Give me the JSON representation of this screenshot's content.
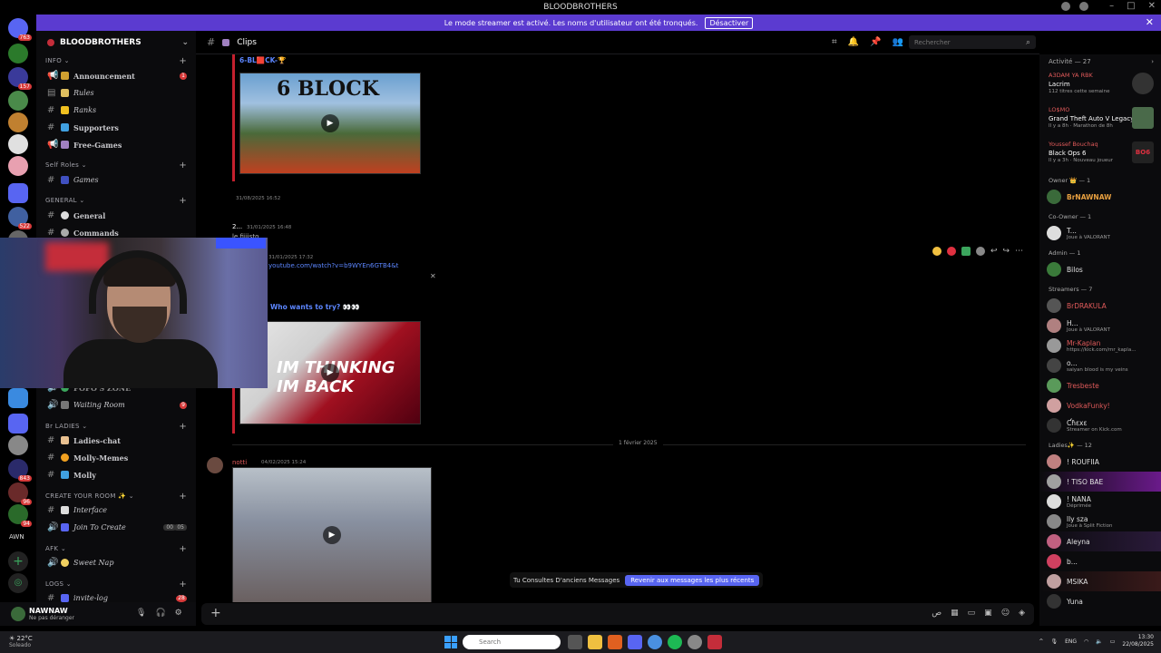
{
  "window": {
    "title": "BLOODBROTHERS"
  },
  "banner": {
    "text": "Le mode streamer est activé. Les noms d'utilisateur ont été tronqués.",
    "button": "Désactiver"
  },
  "guilds": {
    "badges": [
      "763",
      "157",
      "522",
      "843",
      "96",
      "94"
    ],
    "label": "AWN"
  },
  "server": {
    "name": "BLOODBROTHERS"
  },
  "categories": {
    "info": "INFO",
    "self_roles": "Self Roles",
    "general": "GENERAL",
    "br_ladies": "Br LADIES",
    "create_room": "CREATE YOUR ROOM ✨",
    "afk": "AFK",
    "logs": "LOGS"
  },
  "channels": {
    "announcement": "Announcement",
    "rules": "Rules",
    "ranks": "Ranks",
    "supporters": "Supporters",
    "free_games": "Free-Games",
    "games": "Games",
    "general": "General",
    "commands": "Commands",
    "popos_zone": "POPO'S ZONE",
    "waiting_room": "Waiting Room",
    "ladies_chat": "Ladies-chat",
    "molly_memes": "Molly-Memes",
    "molly": "Molly",
    "interface": "Interface",
    "join_to_create": "Join To Create",
    "join_count": "00",
    "join_limit": "05",
    "sweet_nap": "Sweet Nap",
    "invite_log": "invite-log",
    "announcement_badge": "1",
    "waiting_badge": "9",
    "invite_badge": "28"
  },
  "chat": {
    "channel": "Clips",
    "search_placeholder": "Rechercher",
    "embed1_title": "6-BL🟥CK-🏆",
    "msg_ts1": "31/08/2025 16:52",
    "msg_ts2": "31/01/2025 16:48",
    "msg_user2": "2...",
    "msg_text2": "le fiiiisto",
    "msg_ts3": "31/01/2025 17:32",
    "link": "youtube.com/watch?v=b9WYEn6GTB4&t",
    "embed2_title": "Who wants to try? 👀👀",
    "date_divider": "1 février 2025",
    "msg_user4": "notti",
    "msg_ts4": "04/02/2025 15:24",
    "old_msgs_text": "Tu Consultes D'anciens Messages",
    "old_msgs_button": "Revenir aux messages les plus récents"
  },
  "user": {
    "name": "NAWNAW",
    "status": "Ne pas déranger"
  },
  "members": {
    "activity_head": "Activité — 27",
    "activities": [
      {
        "name": "A3DAM YA RBK",
        "game": "Lacrim",
        "meta": "112 titres cette semaine"
      },
      {
        "name": "LO$MO",
        "game": "Grand Theft Auto V Legacy",
        "meta": "Il y a 8h · Marathon de 8h"
      },
      {
        "name": "Youssef Bouchaq",
        "game": "Black Ops 6",
        "meta": "Il y a 3h · Nouveau joueur"
      }
    ],
    "roles": {
      "owner": "Owner 👑 — 1",
      "coowner": "Co-Owner — 1",
      "admin": "Admin — 1",
      "streamers": "Streamers — 7",
      "ladies": "Ladies✨ — 12"
    },
    "list": [
      {
        "name": "BrNAWNAW",
        "status": ""
      },
      {
        "name": "T...",
        "status": "Joue à VALORANT"
      },
      {
        "name": "Bilos",
        "status": ""
      },
      {
        "name": "BrDRAKULA",
        "status": ""
      },
      {
        "name": "H...",
        "status": "Joue à VALORANT"
      },
      {
        "name": "Mr-Kaplan",
        "status": "https://kick.com/mr_kapla..."
      },
      {
        "name": "o...",
        "status": "saiyan blood is my veins"
      },
      {
        "name": "Tresbeste",
        "status": ""
      },
      {
        "name": "VodkaFunky!",
        "status": ""
      },
      {
        "name": "Ƈɦɛxɛ",
        "status": "Streamer on Kick.com"
      },
      {
        "name": "! ROUFIIA",
        "status": ""
      },
      {
        "name": "! TISO BAE",
        "status": ""
      },
      {
        "name": "! NANA",
        "status": "Déprimée"
      },
      {
        "name": "lly sza",
        "status": "Joue à Split Fiction"
      },
      {
        "name": "Aleyna",
        "status": ""
      },
      {
        "name": "b...",
        "status": ""
      },
      {
        "name": "MSIKA",
        "status": ""
      },
      {
        "name": "Yuna",
        "status": ""
      }
    ]
  },
  "taskbar": {
    "temp": "22°C",
    "weather": "Soleado",
    "search": "Search",
    "lang": "ENG",
    "time": "13:30",
    "date": "22/08/2025"
  }
}
